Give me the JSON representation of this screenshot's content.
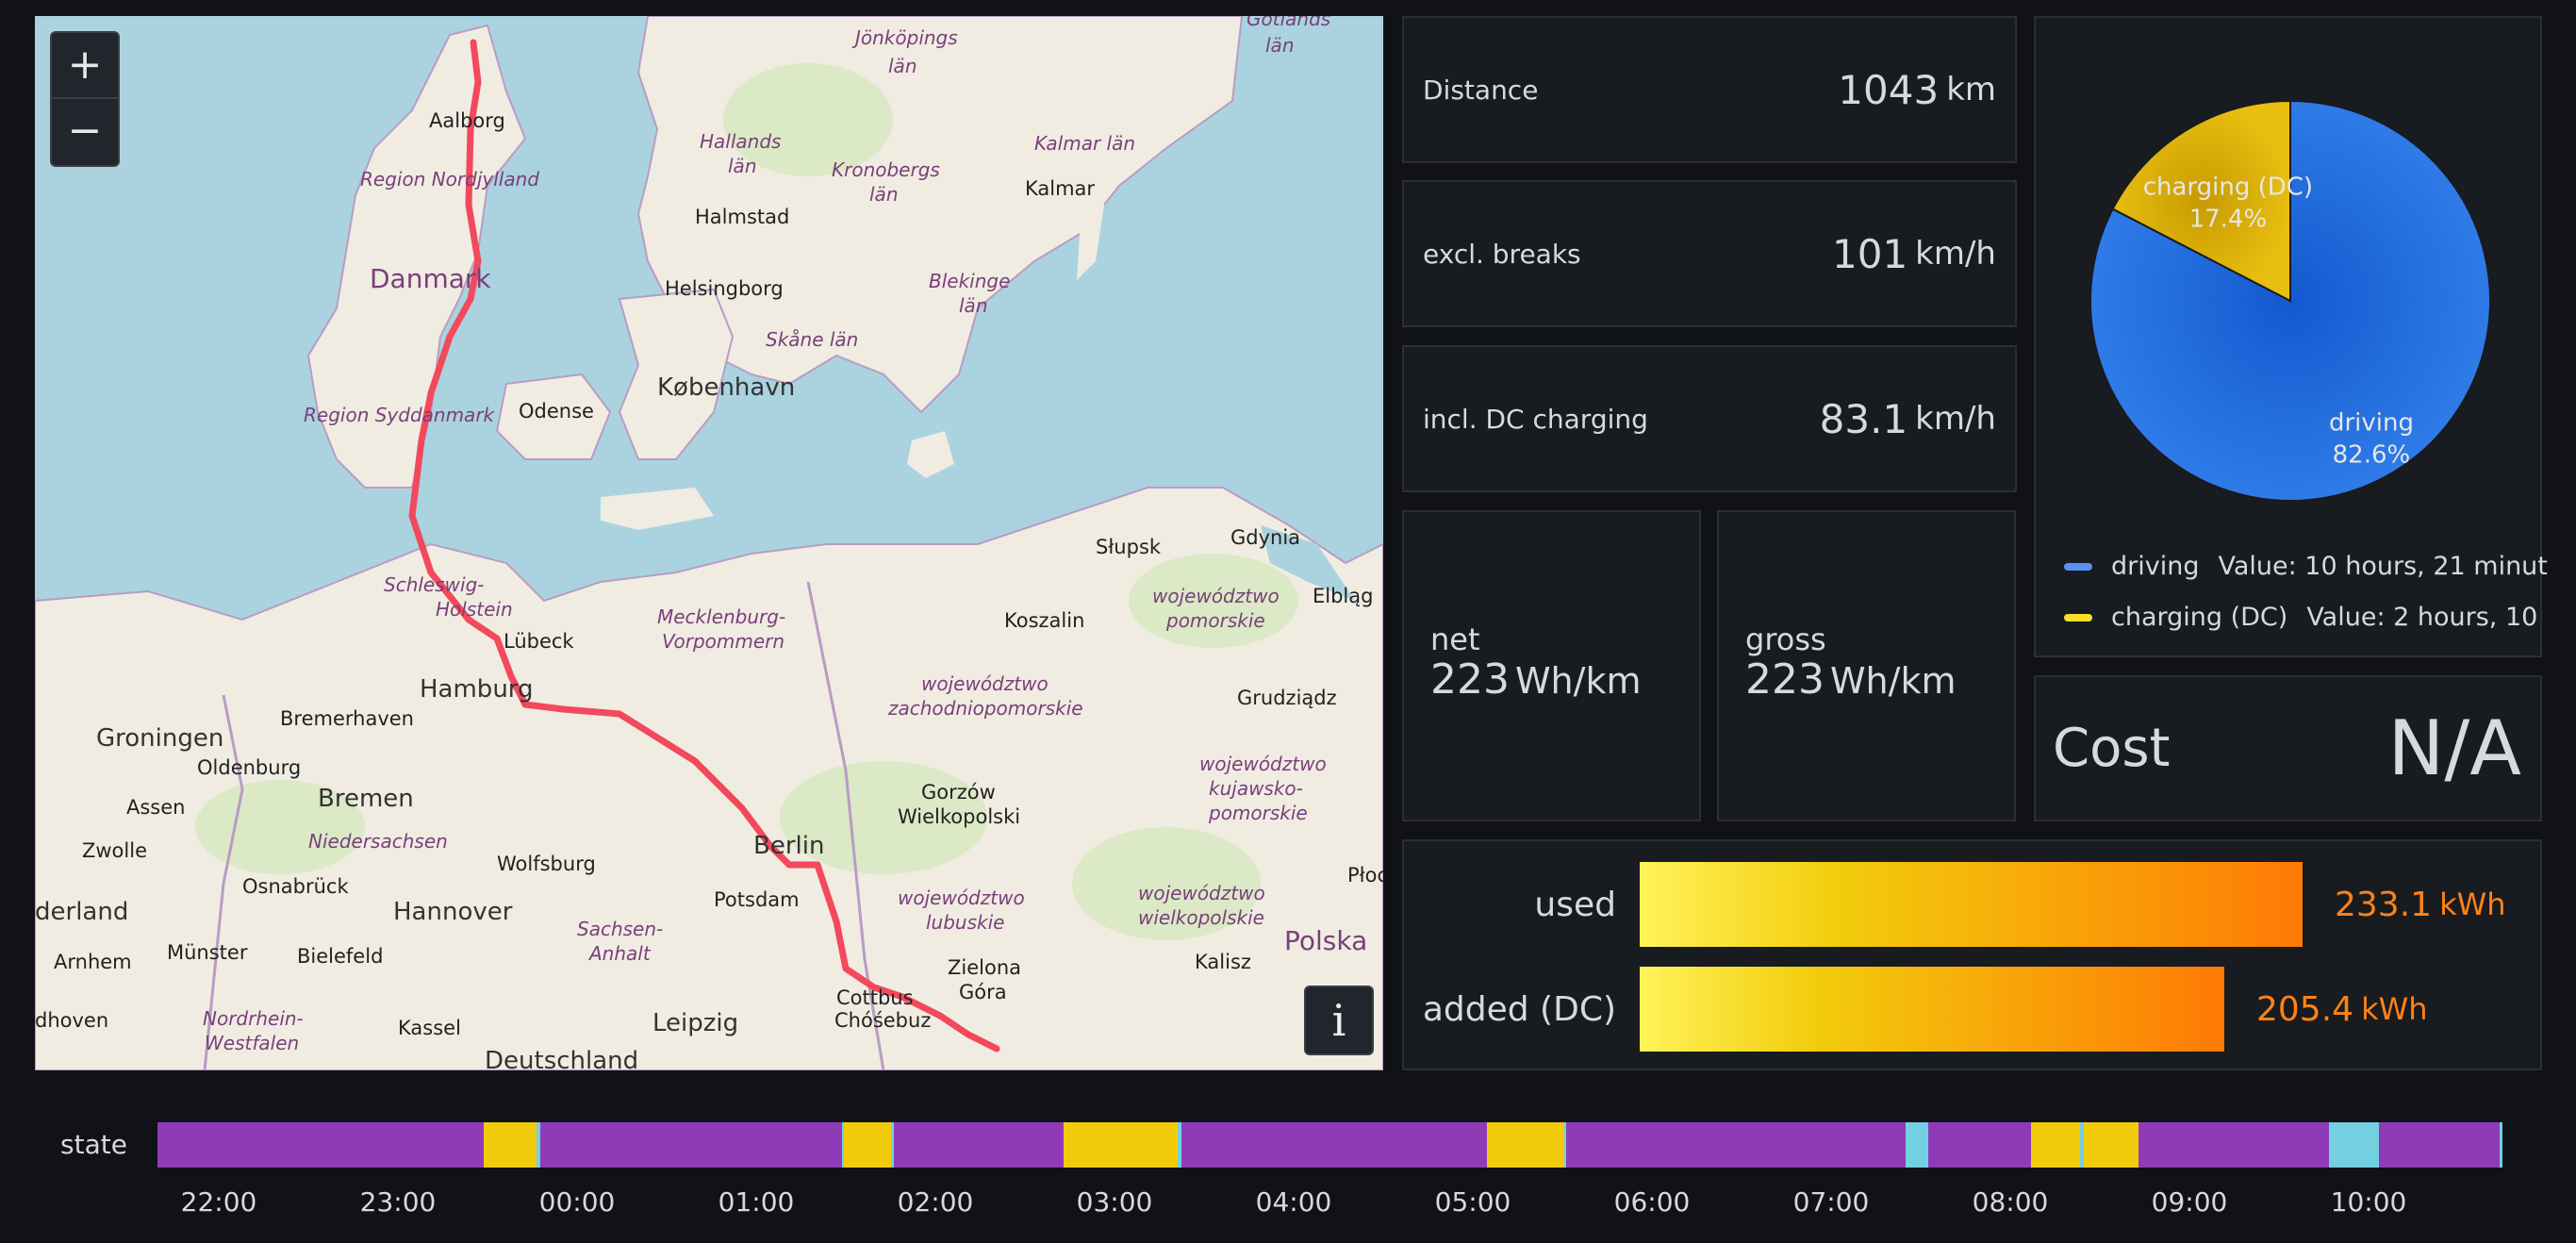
{
  "map": {
    "zoom_in_label": "+",
    "zoom_out_label": "−",
    "info_label": "i",
    "labels": {
      "jonkoping": "Jönköpings",
      "lan1": "län",
      "gotlands": "Gotlands",
      "lan2": "län",
      "hallands": "Hallands",
      "lan3": "län",
      "kronobergs": "Kronobergs",
      "lan4": "län",
      "kalmar_lan": "Kalmar län",
      "kalmar": "Kalmar",
      "aalborg": "Aalborg",
      "nordjylland": "Region Nordjylland",
      "halmstad": "Halmstad",
      "danmark": "Danmark",
      "helsingborg": "Helsingborg",
      "blekinge": "Blekinge",
      "lan5": "län",
      "skane": "Skåne län",
      "kobenhavn": "København",
      "syddanmark": "Region Syddanmark",
      "odense": "Odense",
      "slupsk": "Słupsk",
      "gdynia": "Gdynia",
      "wojewodztwo1": "województwo",
      "pomorskie": "pomorskie",
      "elblag": "Elbląg",
      "schleswig": "Schleswig-",
      "holstein": "Holstein",
      "lubeck": "Lübeck",
      "mecklenburg": "Mecklenburg-",
      "vorpommern": "Vorpommern",
      "koszalin": "Koszalin",
      "hamburg": "Hamburg",
      "wojewodztwo2": "województwo",
      "zachodniopomorskie": "zachodniopomorskie",
      "grudziadz": "Grudziądz",
      "groningen": "Groningen",
      "bremerhaven": "Bremerhaven",
      "oldenburg": "Oldenburg",
      "bremen": "Bremen",
      "assen": "Assen",
      "gorzow": "Gorzów",
      "wielkopolski": "Wielkopolski",
      "wojewodztwo3": "województwo",
      "kujawsko": "kujawsko-",
      "pomorskie2": "pomorskie",
      "zwolle": "Zwolle",
      "niedersachsen": "Niedersachsen",
      "wolfsburg": "Wolfsburg",
      "berlin": "Berlin",
      "osnabruck": "Osnabrück",
      "potsdam": "Potsdam",
      "wojewodztwo4": "województwo",
      "lubuskie": "lubuskie",
      "wojewodztwo5": "województwo",
      "wielkopolskie": "wielkopolskie",
      "plock": "Płoc",
      "nederland": "derland",
      "hannover": "Hannover",
      "arnhem": "Arnhem",
      "munster": "Münster",
      "bielefeld": "Bielefeld",
      "sachsen_anhalt1": "Sachsen-",
      "sachsen_anhalt2": "Anhalt",
      "zielona": "Zielona",
      "gora": "Góra",
      "kalisz": "Kalisz",
      "polska": "Polska",
      "dhoven": "dhoven",
      "nrw1": "Nordrhein-",
      "nrw2": "Westfalen",
      "kassel": "Kassel",
      "leipzig": "Leipzig",
      "cottbus": "Cottbus",
      "chosebuz": "Chóśebuz",
      "deutschland": "Deutschland"
    }
  },
  "stats": {
    "distance": {
      "label": "Distance",
      "value": "1043",
      "unit": "km"
    },
    "excl_breaks": {
      "label": "excl. breaks",
      "value": "101",
      "unit": "km/h"
    },
    "incl_dc": {
      "label": "incl. DC charging",
      "value": "83.1",
      "unit": "km/h"
    },
    "net": {
      "label": "net",
      "value": "223",
      "unit": "Wh/km"
    },
    "gross": {
      "label": "gross",
      "value": "223",
      "unit": "Wh/km"
    }
  },
  "pie": {
    "slices": [
      {
        "name": "driving",
        "pct_label": "82.6%",
        "fraction": 0.826,
        "color": "#3b7fe8"
      },
      {
        "name": "charging (DC)",
        "pct_label": "17.4%",
        "fraction": 0.174,
        "color": "#e0b400"
      }
    ],
    "legend": [
      {
        "name": "driving",
        "value": "Value: 10 hours, 21 minut",
        "color": "#5794f2"
      },
      {
        "name": "charging (DC)",
        "value": "Value: 2 hours, 10",
        "color": "#fade2a"
      }
    ]
  },
  "cost": {
    "label": "Cost",
    "value": "N/A"
  },
  "energy": {
    "rows": [
      {
        "label": "used",
        "value": "233.1",
        "unit": "kWh",
        "fraction": 0.703
      },
      {
        "label": "added (DC)",
        "value": "205.4",
        "unit": "kWh",
        "fraction": 0.62
      }
    ]
  },
  "timeline": {
    "label": "state",
    "colors": {
      "driving": "#8f3bb8",
      "charging": "#f2cc0c",
      "other": "#73d0e0"
    },
    "segments": [
      {
        "state": "driving",
        "weight": 346
      },
      {
        "state": "charging",
        "weight": 56
      },
      {
        "state": "other",
        "weight": 4
      },
      {
        "state": "driving",
        "weight": 320
      },
      {
        "state": "other",
        "weight": 2
      },
      {
        "state": "charging",
        "weight": 50
      },
      {
        "state": "other",
        "weight": 3
      },
      {
        "state": "driving",
        "weight": 180
      },
      {
        "state": "charging",
        "weight": 121
      },
      {
        "state": "other",
        "weight": 4
      },
      {
        "state": "driving",
        "weight": 323
      },
      {
        "state": "charging",
        "weight": 82
      },
      {
        "state": "other",
        "weight": 2
      },
      {
        "state": "driving",
        "weight": 360
      },
      {
        "state": "other",
        "weight": 24
      },
      {
        "state": "driving",
        "weight": 109
      },
      {
        "state": "charging",
        "weight": 52
      },
      {
        "state": "other",
        "weight": 4
      },
      {
        "state": "charging",
        "weight": 58
      },
      {
        "state": "driving",
        "weight": 202
      },
      {
        "state": "other",
        "weight": 53
      },
      {
        "state": "driving",
        "weight": 128
      },
      {
        "state": "other",
        "weight": 3
      }
    ],
    "ticks": [
      "22:00",
      "23:00",
      "00:00",
      "01:00",
      "02:00",
      "03:00",
      "04:00",
      "05:00",
      "06:00",
      "07:00",
      "08:00",
      "09:00",
      "10:00"
    ]
  }
}
